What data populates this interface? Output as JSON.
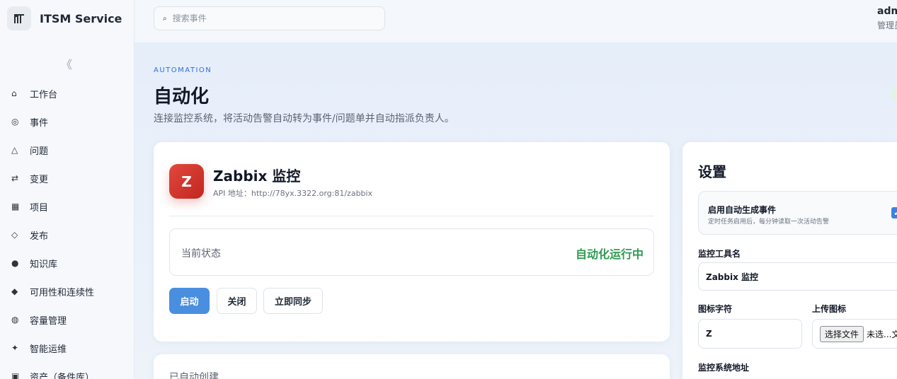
{
  "brand": {
    "name": "ITSM Service",
    "logo_glyph": "M"
  },
  "sidebar": {
    "collapse_glyph": "《",
    "items": [
      {
        "icon": "⌂",
        "icon_name": "home-icon",
        "label": "工作台"
      },
      {
        "icon": "◎",
        "icon_name": "target-icon",
        "label": "事件"
      },
      {
        "icon": "△",
        "icon_name": "triangle-icon",
        "label": "问题"
      },
      {
        "icon": "⇄",
        "icon_name": "swap-icon",
        "label": "变更"
      },
      {
        "icon": "▦",
        "icon_name": "grid-icon",
        "label": "项目"
      },
      {
        "icon": "◇",
        "icon_name": "diamond-outline-icon",
        "label": "发布"
      },
      {
        "icon": "●",
        "icon_name": "dot-icon",
        "label": "知识库"
      },
      {
        "icon": "◆",
        "icon_name": "diamond-icon",
        "label": "可用性和连续性"
      },
      {
        "icon": "◍",
        "icon_name": "circle-icon",
        "label": "容量管理"
      },
      {
        "icon": "✦",
        "icon_name": "sparkle-icon",
        "label": "智能运维"
      },
      {
        "icon": "▣",
        "icon_name": "box-icon",
        "label": "资产（备件库）"
      }
    ]
  },
  "topbar": {
    "search_placeholder": "搜索事件",
    "user_name": "admin",
    "user_role": "管理员"
  },
  "page": {
    "eyebrow": "AUTOMATION",
    "title": "自动化",
    "description": "连接监控系统，将活动告警自动转为事件/问题单并自动指派负责人。"
  },
  "tool": {
    "logo_char": "Z",
    "name": "Zabbix 监控",
    "api": "API 地址：http://78yx.3322.org:81/zabbix",
    "status_label": "当前状态",
    "status_value": "自动化运行中",
    "status_color": "#2f9a52",
    "buttons": {
      "start": "启动",
      "close": "关闭",
      "sync": "立即同步"
    },
    "accent": "#4a8ee0"
  },
  "created": {
    "label": "已自动创建"
  },
  "settings": {
    "title": "设置",
    "auto_create_title": "启用自动生成事件",
    "auto_create_desc": "定时任务启用后，每分钟读取一次活动告警",
    "auto_create_checked": "✔",
    "tool_name_label": "监控工具名",
    "tool_name_value": "Zabbix 监控",
    "icon_char_label": "图标字符",
    "icon_char_value": "Z",
    "upload_label": "上传图标",
    "file_button": "选择文件",
    "file_status": "未选...文",
    "address_label": "监控系统地址"
  }
}
